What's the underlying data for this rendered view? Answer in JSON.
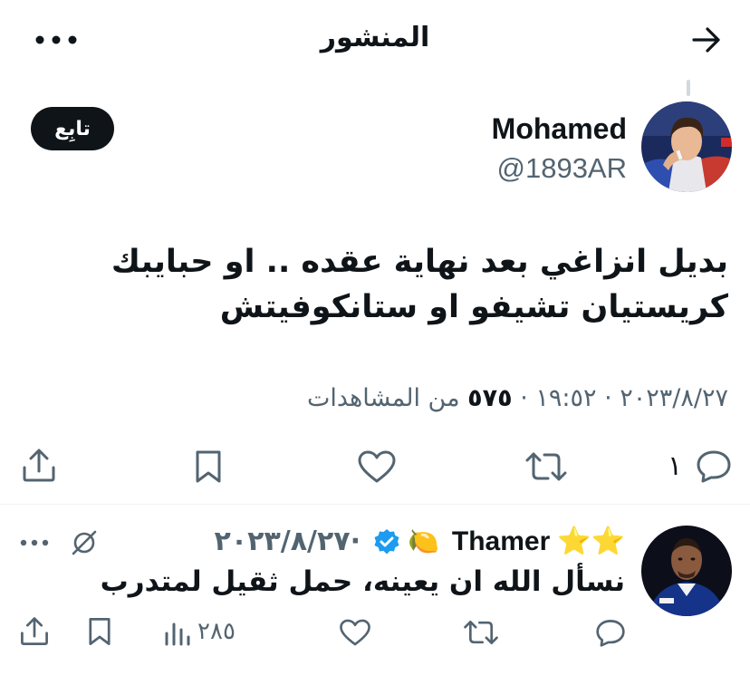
{
  "header": {
    "title": "المنشور",
    "back_icon": "arrow-right-icon",
    "more_icon": "more-horizontal-icon"
  },
  "post": {
    "author_name": "Mohamed",
    "author_handle": "@1893AR",
    "follow_label": "تابِع",
    "text_line1": "بديل انزاغي بعد نهاية عقده .. او حبايبك",
    "text_line2": "كريستيان تشيفو او ستانكوفيتش",
    "date": "٢٠٢٣/٨/٢٧",
    "time": "١٩:٥٢",
    "separator": "·",
    "views_count": "٥٧٥",
    "views_label": "من المشاهدات",
    "replies_count": "١",
    "actions": [
      "reply-icon",
      "retweet-icon",
      "like-icon",
      "bookmark-icon",
      "share-icon"
    ]
  },
  "reply": {
    "stars_prefix": "⭐⭐",
    "name": "Thamer",
    "emoji_suffix": "🍋",
    "verified": true,
    "date": "٢٠٢٣/٨/٢٧",
    "separator": "·",
    "text": "نسأل الله ان يعينه، حمل ثقيل لمتدرب",
    "views_count": "٢٨٥",
    "actions": [
      "reply-icon",
      "retweet-icon",
      "like-icon",
      "views-icon",
      "bookmark-icon",
      "share-icon"
    ]
  },
  "colors": {
    "text": "#0f1419",
    "secondary": "#536471",
    "verified": "#1d9bf0",
    "divider": "#eff3f4"
  }
}
